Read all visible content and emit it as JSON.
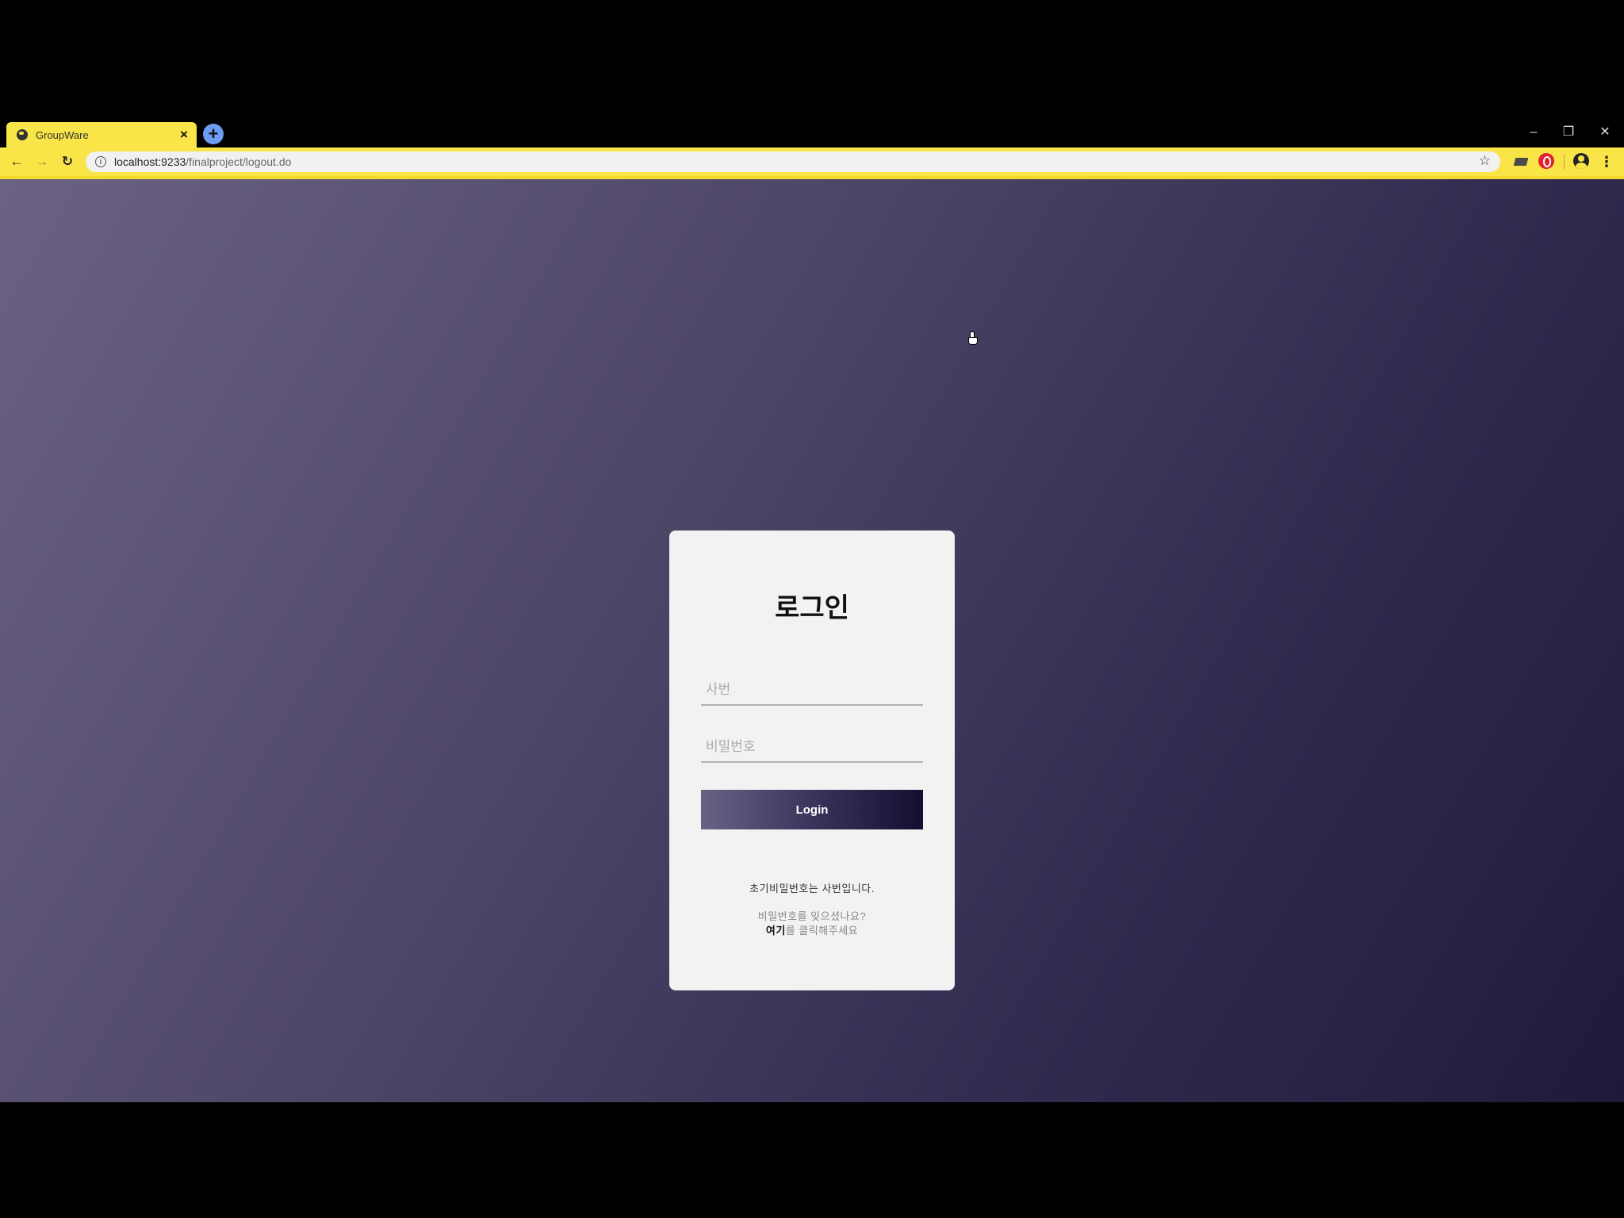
{
  "browser": {
    "tab_title": "GroupWare",
    "tab_close": "×",
    "new_tab": "+",
    "window_controls": {
      "minimize": "–",
      "restore": "❐",
      "close": "✕"
    },
    "url_host": "localhost:9233",
    "url_path": "/finalproject/logout.do",
    "accent_color": "#f9e547"
  },
  "login": {
    "title": "로그인",
    "id_placeholder": "사번",
    "password_placeholder": "비밀번호",
    "button_label": "Login",
    "hint": "초기비밀번호는 사번입니다.",
    "forgot_text": "비밀번호를 잊으셨나요?",
    "here_link": "여기",
    "here_suffix": "를 클릭해주세요"
  }
}
